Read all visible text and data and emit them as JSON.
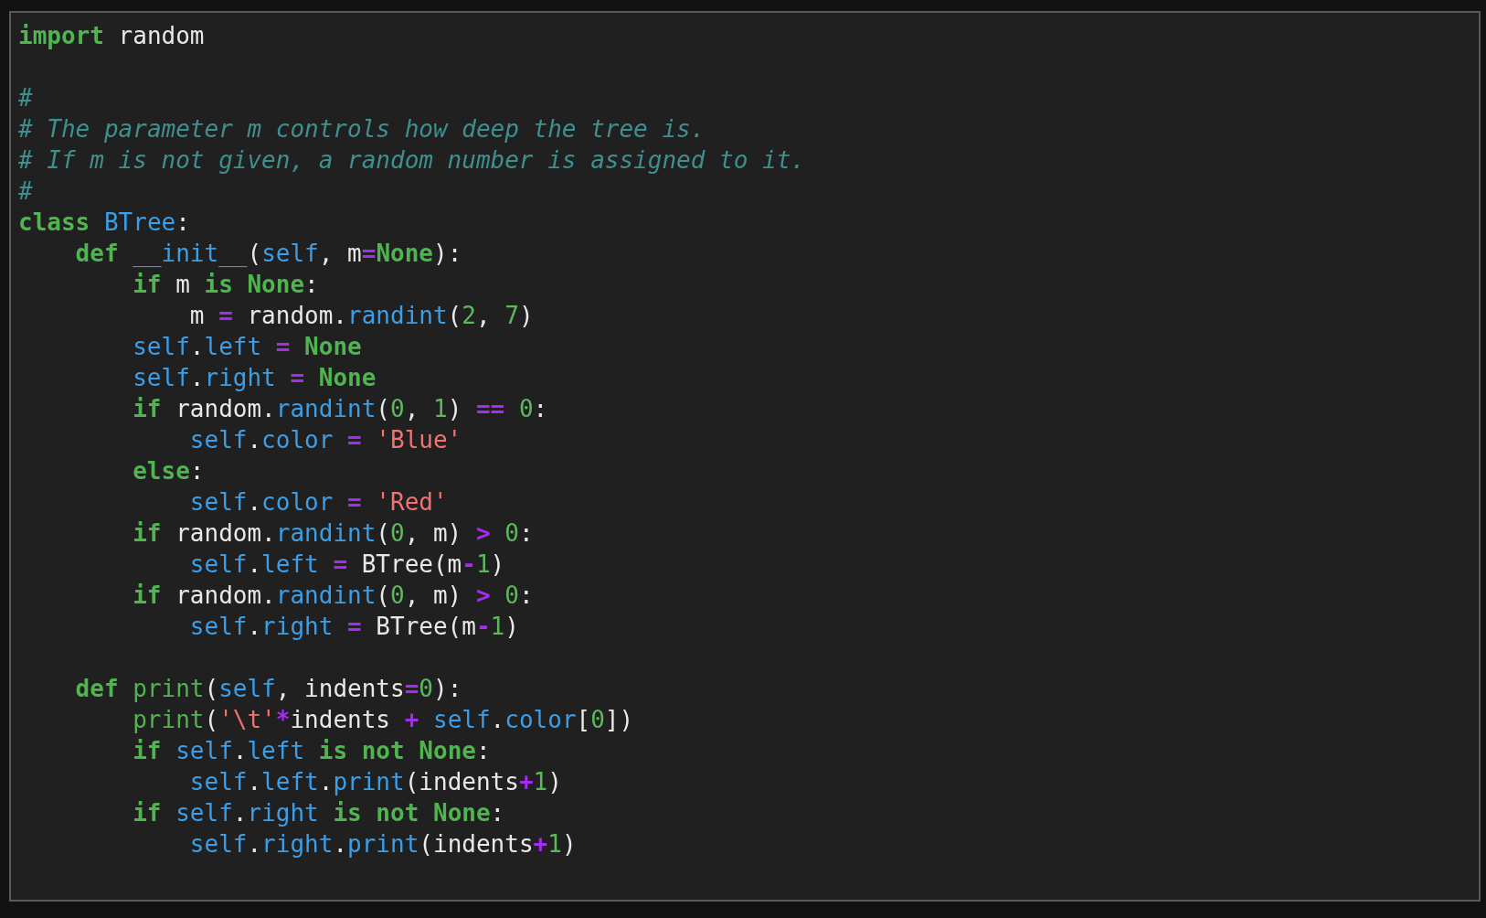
{
  "editor": {
    "lines": [
      {
        "kind": "code",
        "tokens": [
          {
            "kind": "keyword",
            "text": "import"
          },
          {
            "kind": "name",
            "text": " random"
          }
        ]
      },
      {
        "kind": "blank"
      },
      {
        "kind": "code",
        "tokens": [
          {
            "kind": "comment",
            "text": "#"
          }
        ]
      },
      {
        "kind": "code",
        "tokens": [
          {
            "kind": "comment",
            "text": "# The parameter m controls how deep the tree is."
          }
        ]
      },
      {
        "kind": "code",
        "tokens": [
          {
            "kind": "comment",
            "text": "# If m is not given, a random number is assigned to it."
          }
        ]
      },
      {
        "kind": "code",
        "tokens": [
          {
            "kind": "comment",
            "text": "#"
          }
        ]
      },
      {
        "kind": "code",
        "tokens": [
          {
            "kind": "keyword",
            "text": "class"
          },
          {
            "kind": "attr",
            "text": " BTree"
          },
          {
            "kind": "name",
            "text": ":"
          }
        ],
        "children": [
          {
            "kind": "code",
            "tokens": [
              {
                "kind": "keyword",
                "text": "def"
              },
              {
                "kind": "attr",
                "text": " __init__"
              },
              {
                "kind": "name",
                "text": "("
              },
              {
                "kind": "attr",
                "text": "self"
              },
              {
                "kind": "name",
                "text": ", m"
              },
              {
                "kind": "op",
                "text": "="
              },
              {
                "kind": "keyword",
                "text": "None"
              },
              {
                "kind": "name",
                "text": "):"
              }
            ],
            "children": [
              {
                "kind": "code",
                "tokens": [
                  {
                    "kind": "keyword",
                    "text": "if"
                  },
                  {
                    "kind": "name",
                    "text": " m "
                  },
                  {
                    "kind": "keyword",
                    "text": "is None"
                  },
                  {
                    "kind": "name",
                    "text": ":"
                  }
                ],
                "children": [
                  {
                    "kind": "code",
                    "tokens": [
                      {
                        "kind": "name",
                        "text": "m "
                      },
                      {
                        "kind": "op",
                        "text": "="
                      },
                      {
                        "kind": "name",
                        "text": " random."
                      },
                      {
                        "kind": "attr",
                        "text": "randint"
                      },
                      {
                        "kind": "name",
                        "text": "("
                      },
                      {
                        "kind": "number",
                        "text": "2"
                      },
                      {
                        "kind": "name",
                        "text": ", "
                      },
                      {
                        "kind": "number",
                        "text": "7"
                      },
                      {
                        "kind": "name",
                        "text": ")"
                      }
                    ]
                  }
                ]
              },
              {
                "kind": "code",
                "tokens": [
                  {
                    "kind": "attr",
                    "text": "self"
                  },
                  {
                    "kind": "name",
                    "text": "."
                  },
                  {
                    "kind": "attr",
                    "text": "left"
                  },
                  {
                    "kind": "op",
                    "text": " ="
                  },
                  {
                    "kind": "keyword",
                    "text": " None"
                  }
                ]
              },
              {
                "kind": "code",
                "tokens": [
                  {
                    "kind": "attr",
                    "text": "self"
                  },
                  {
                    "kind": "name",
                    "text": "."
                  },
                  {
                    "kind": "attr",
                    "text": "right"
                  },
                  {
                    "kind": "op",
                    "text": " ="
                  },
                  {
                    "kind": "keyword",
                    "text": " None"
                  }
                ]
              },
              {
                "kind": "code",
                "tokens": [
                  {
                    "kind": "keyword",
                    "text": "if"
                  },
                  {
                    "kind": "name",
                    "text": " random."
                  },
                  {
                    "kind": "attr",
                    "text": "randint"
                  },
                  {
                    "kind": "name",
                    "text": "("
                  },
                  {
                    "kind": "number",
                    "text": "0"
                  },
                  {
                    "kind": "name",
                    "text": ", "
                  },
                  {
                    "kind": "number",
                    "text": "1"
                  },
                  {
                    "kind": "name",
                    "text": ") "
                  },
                  {
                    "kind": "op",
                    "text": "=="
                  },
                  {
                    "kind": "number",
                    "text": " 0"
                  },
                  {
                    "kind": "name",
                    "text": ":"
                  }
                ],
                "children": [
                  {
                    "kind": "code",
                    "tokens": [
                      {
                        "kind": "attr",
                        "text": "self"
                      },
                      {
                        "kind": "name",
                        "text": "."
                      },
                      {
                        "kind": "attr",
                        "text": "color"
                      },
                      {
                        "kind": "op",
                        "text": " ="
                      },
                      {
                        "kind": "string",
                        "text": " 'Blue'"
                      }
                    ]
                  }
                ]
              },
              {
                "kind": "code",
                "tokens": [
                  {
                    "kind": "keyword",
                    "text": "else"
                  },
                  {
                    "kind": "name",
                    "text": ":"
                  }
                ],
                "children": [
                  {
                    "kind": "code",
                    "tokens": [
                      {
                        "kind": "attr",
                        "text": "self"
                      },
                      {
                        "kind": "name",
                        "text": "."
                      },
                      {
                        "kind": "attr",
                        "text": "color"
                      },
                      {
                        "kind": "op",
                        "text": " ="
                      },
                      {
                        "kind": "string",
                        "text": " 'Red'"
                      }
                    ]
                  }
                ]
              },
              {
                "kind": "code",
                "tokens": [
                  {
                    "kind": "keyword",
                    "text": "if"
                  },
                  {
                    "kind": "name",
                    "text": " random."
                  },
                  {
                    "kind": "attr",
                    "text": "randint"
                  },
                  {
                    "kind": "name",
                    "text": "("
                  },
                  {
                    "kind": "number",
                    "text": "0"
                  },
                  {
                    "kind": "name",
                    "text": ", m) "
                  },
                  {
                    "kind": "op",
                    "text": ">"
                  },
                  {
                    "kind": "number",
                    "text": " 0"
                  },
                  {
                    "kind": "name",
                    "text": ":"
                  }
                ],
                "children": [
                  {
                    "kind": "code",
                    "tokens": [
                      {
                        "kind": "attr",
                        "text": "self"
                      },
                      {
                        "kind": "name",
                        "text": "."
                      },
                      {
                        "kind": "attr",
                        "text": "left"
                      },
                      {
                        "kind": "op",
                        "text": " ="
                      },
                      {
                        "kind": "name",
                        "text": " BTree(m"
                      },
                      {
                        "kind": "op",
                        "text": "-"
                      },
                      {
                        "kind": "number",
                        "text": "1"
                      },
                      {
                        "kind": "name",
                        "text": ")"
                      }
                    ]
                  }
                ]
              },
              {
                "kind": "code",
                "tokens": [
                  {
                    "kind": "keyword",
                    "text": "if"
                  },
                  {
                    "kind": "name",
                    "text": " random."
                  },
                  {
                    "kind": "attr",
                    "text": "randint"
                  },
                  {
                    "kind": "name",
                    "text": "("
                  },
                  {
                    "kind": "number",
                    "text": "0"
                  },
                  {
                    "kind": "name",
                    "text": ", m) "
                  },
                  {
                    "kind": "op",
                    "text": ">"
                  },
                  {
                    "kind": "number",
                    "text": " 0"
                  },
                  {
                    "kind": "name",
                    "text": ":"
                  }
                ],
                "children": [
                  {
                    "kind": "code",
                    "tokens": [
                      {
                        "kind": "attr",
                        "text": "self"
                      },
                      {
                        "kind": "name",
                        "text": "."
                      },
                      {
                        "kind": "attr",
                        "text": "right"
                      },
                      {
                        "kind": "op",
                        "text": " ="
                      },
                      {
                        "kind": "name",
                        "text": " BTree(m"
                      },
                      {
                        "kind": "op",
                        "text": "-"
                      },
                      {
                        "kind": "number",
                        "text": "1"
                      },
                      {
                        "kind": "name",
                        "text": ")"
                      }
                    ]
                  }
                ]
              }
            ]
          },
          {
            "kind": "blank"
          },
          {
            "kind": "code",
            "tokens": [
              {
                "kind": "keyword",
                "text": "def"
              },
              {
                "kind": "builtin",
                "text": " print"
              },
              {
                "kind": "name",
                "text": "("
              },
              {
                "kind": "attr",
                "text": "self"
              },
              {
                "kind": "name",
                "text": ", indents"
              },
              {
                "kind": "op",
                "text": "="
              },
              {
                "kind": "number",
                "text": "0"
              },
              {
                "kind": "name",
                "text": "):"
              }
            ],
            "children": [
              {
                "kind": "code",
                "tokens": [
                  {
                    "kind": "builtin",
                    "text": "print"
                  },
                  {
                    "kind": "name",
                    "text": "("
                  },
                  {
                    "kind": "string",
                    "text": "'\\t'"
                  },
                  {
                    "kind": "op",
                    "text": "*"
                  },
                  {
                    "kind": "name",
                    "text": "indents "
                  },
                  {
                    "kind": "op",
                    "text": "+"
                  },
                  {
                    "kind": "attr",
                    "text": " self"
                  },
                  {
                    "kind": "name",
                    "text": "."
                  },
                  {
                    "kind": "attr",
                    "text": "color"
                  },
                  {
                    "kind": "name",
                    "text": "["
                  },
                  {
                    "kind": "number",
                    "text": "0"
                  },
                  {
                    "kind": "name",
                    "text": "])"
                  }
                ]
              },
              {
                "kind": "code",
                "tokens": [
                  {
                    "kind": "keyword",
                    "text": "if"
                  },
                  {
                    "kind": "attr",
                    "text": " self"
                  },
                  {
                    "kind": "name",
                    "text": "."
                  },
                  {
                    "kind": "attr",
                    "text": "left"
                  },
                  {
                    "kind": "keyword",
                    "text": " is not None"
                  },
                  {
                    "kind": "name",
                    "text": ":"
                  }
                ],
                "children": [
                  {
                    "kind": "code",
                    "tokens": [
                      {
                        "kind": "attr",
                        "text": "self"
                      },
                      {
                        "kind": "name",
                        "text": "."
                      },
                      {
                        "kind": "attr",
                        "text": "left"
                      },
                      {
                        "kind": "name",
                        "text": "."
                      },
                      {
                        "kind": "attr",
                        "text": "print"
                      },
                      {
                        "kind": "name",
                        "text": "(indents"
                      },
                      {
                        "kind": "op",
                        "text": "+"
                      },
                      {
                        "kind": "number",
                        "text": "1"
                      },
                      {
                        "kind": "name",
                        "text": ")"
                      }
                    ]
                  }
                ]
              },
              {
                "kind": "code",
                "tokens": [
                  {
                    "kind": "keyword",
                    "text": "if"
                  },
                  {
                    "kind": "attr",
                    "text": " self"
                  },
                  {
                    "kind": "name",
                    "text": "."
                  },
                  {
                    "kind": "attr",
                    "text": "right"
                  },
                  {
                    "kind": "keyword",
                    "text": " is not None"
                  },
                  {
                    "kind": "name",
                    "text": ":"
                  }
                ],
                "children": [
                  {
                    "kind": "code",
                    "tokens": [
                      {
                        "kind": "attr",
                        "text": "self"
                      },
                      {
                        "kind": "name",
                        "text": "."
                      },
                      {
                        "kind": "attr",
                        "text": "right"
                      },
                      {
                        "kind": "name",
                        "text": "."
                      },
                      {
                        "kind": "attr",
                        "text": "print"
                      },
                      {
                        "kind": "name",
                        "text": "(indents"
                      },
                      {
                        "kind": "op",
                        "text": "+"
                      },
                      {
                        "kind": "number",
                        "text": "1"
                      },
                      {
                        "kind": "name",
                        "text": ")"
                      }
                    ]
                  }
                ]
              }
            ]
          }
        ]
      }
    ]
  }
}
